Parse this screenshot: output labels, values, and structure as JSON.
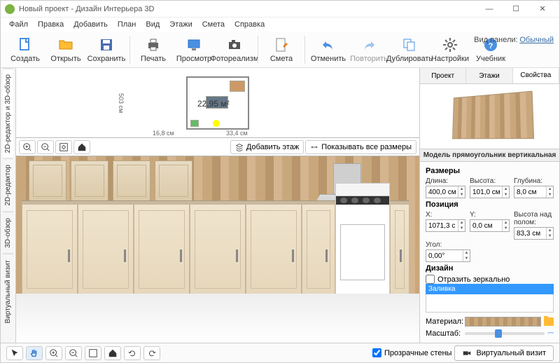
{
  "window": {
    "title": "Новый проект - Дизайн Интерьера 3D"
  },
  "menu": [
    "Файл",
    "Правка",
    "Добавить",
    "План",
    "Вид",
    "Этажи",
    "Смета",
    "Справка"
  ],
  "viewmode": {
    "label": "Вид панели:",
    "value": "Обычный"
  },
  "toolbar": {
    "create": "Создать",
    "open": "Открыть",
    "save": "Сохранить",
    "print": "Печать",
    "preview": "Просмотр",
    "photoreal": "Фотореализм",
    "estimate": "Смета",
    "undo": "Отменить",
    "redo": "Повторить",
    "duplicate": "Дублировать",
    "settings": "Настройки",
    "tutorial": "Учебник"
  },
  "vtabs": [
    "2D-редактор и 3D-обзор",
    "2D-редактор",
    "3D-обзор",
    "Виртуальный визит"
  ],
  "plan": {
    "area": "22,95 м²",
    "dim_left": "503 см",
    "dim_bot_l": "16,8 см",
    "dim_bot_r": "33,4 см"
  },
  "midbar": {
    "add_floor": "Добавить этаж",
    "show_dims": "Показывать все размеры"
  },
  "status": {
    "transparent_walls": "Прозрачные стены",
    "virtual_visit": "Виртуальный визит"
  },
  "props": {
    "tabs": [
      "Проект",
      "Этажи",
      "Свойства"
    ],
    "model_name": "Модель прямоугольник вертикальная",
    "sizes_hdr": "Размеры",
    "length_lbl": "Длина:",
    "length_val": "400,0 см",
    "height_lbl": "Высота:",
    "height_val": "101,0 см",
    "depth_lbl": "Глубина:",
    "depth_val": "8,0 см",
    "pos_hdr": "Позиция",
    "x_lbl": "X:",
    "x_val": "1071,3 см",
    "y_lbl": "Y:",
    "y_val": "0,0 см",
    "z_lbl": "Высота над полом:",
    "z_val": "83,3 см",
    "angle_lbl": "Угол:",
    "angle_val": "0,00°",
    "design_hdr": "Дизайн",
    "mirror_lbl": "Отразить зеркально",
    "fill_lbl": "Заливка",
    "material_lbl": "Материал:",
    "scale_lbl": "Масштаб:"
  }
}
